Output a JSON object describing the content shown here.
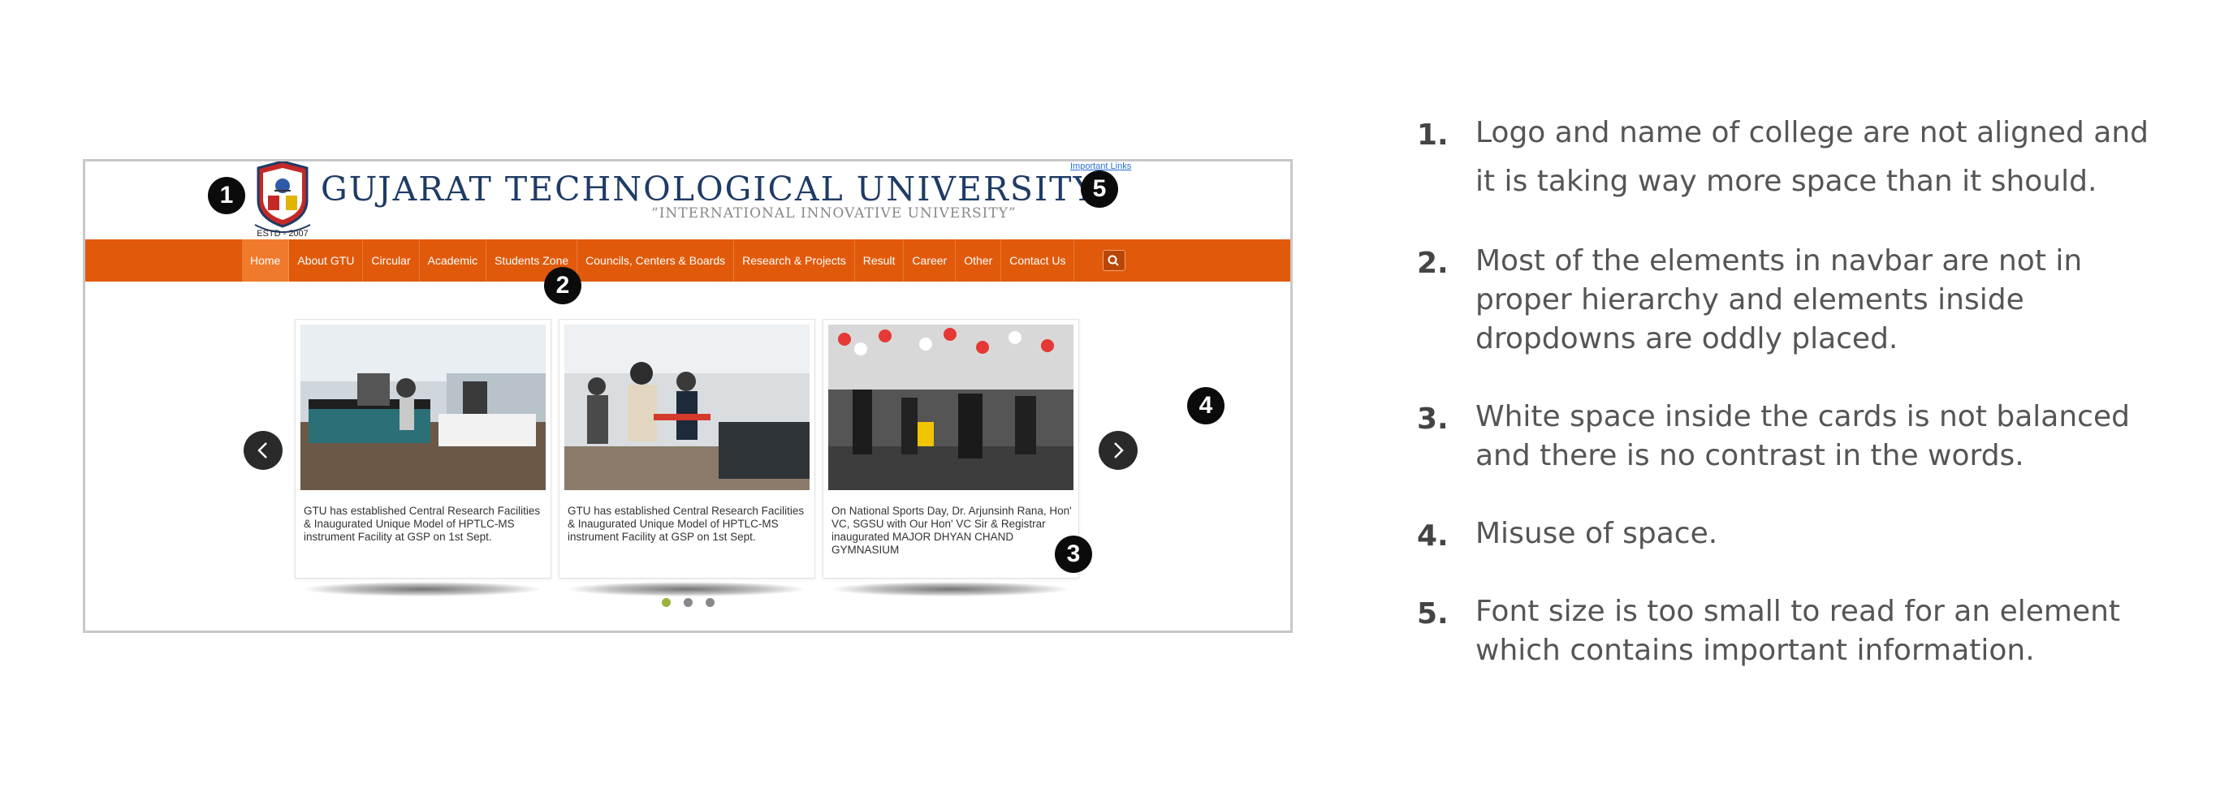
{
  "screenshot": {
    "header": {
      "university_name": "GUJARAT TECHNOLOGICAL UNIVERSITY",
      "tagline": "“INTERNATIONAL INNOVATIVE UNIVERSITY”",
      "logo_text": "ESTD - 2007",
      "important_links": "Important Links"
    },
    "nav": {
      "items": [
        {
          "label": "Home"
        },
        {
          "label": "About GTU"
        },
        {
          "label": "Circular"
        },
        {
          "label": "Academic"
        },
        {
          "label": "Students Zone"
        },
        {
          "label": "Councils, Centers & Boards"
        },
        {
          "label": "Research & Projects"
        },
        {
          "label": "Result"
        },
        {
          "label": "Career"
        },
        {
          "label": "Other"
        },
        {
          "label": "Contact Us"
        }
      ],
      "search_icon": "search-icon"
    },
    "carousel": {
      "cards": [
        {
          "caption": "GTU has established Central Research Facilities & Inaugurated Unique Model of HPTLC-MS instrument Facility at GSP on 1st Sept."
        },
        {
          "caption": "GTU has established Central Research Facilities & Inaugurated Unique Model of HPTLC-MS instrument Facility at GSP on 1st Sept."
        },
        {
          "caption": "On National Sports Day, Dr. Arjunsinh Rana, Hon' VC, SGSU with Our Hon' VC Sir & Registrar inaugurated MAJOR DHYAN CHAND GYMNASIUM"
        }
      ],
      "active_dot": 1,
      "dot_count": 3
    },
    "markers": [
      "1",
      "2",
      "3",
      "4",
      "5"
    ]
  },
  "notes": [
    {
      "num": "1.",
      "text": "Logo and name of college are not aligned and it is taking way more space than it should."
    },
    {
      "num": "2.",
      "text": "Most of the elements in navbar are not in proper hierarchy and elements inside dropdowns are oddly placed."
    },
    {
      "num": "3.",
      "text": "White space inside the cards is not balanced and there is no contrast in the words."
    },
    {
      "num": "4.",
      "text": "Misuse of space."
    },
    {
      "num": "5.",
      "text": "Font size is too small to read for an element which contains important information."
    }
  ],
  "colors": {
    "nav_bg": "#e15a0b",
    "brand_blue": "#1f3b66",
    "dot_active": "#9bb23e"
  }
}
